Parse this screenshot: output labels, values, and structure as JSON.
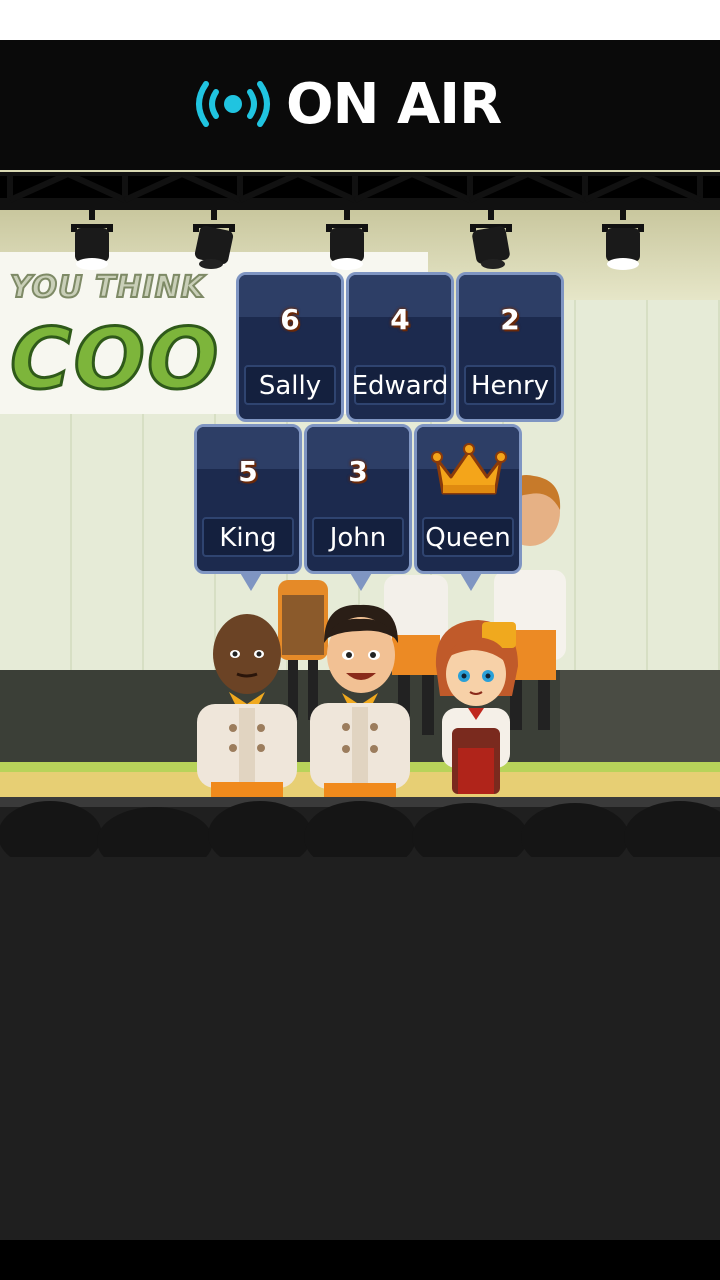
{
  "header": {
    "title": "ON AIR",
    "icon": "broadcast-icon"
  },
  "banner": {
    "line1": "YOU THINK",
    "line2": "COO"
  },
  "rankings": [
    {
      "rank": "6",
      "name": "Sally"
    },
    {
      "rank": "4",
      "name": "Edward"
    },
    {
      "rank": "2",
      "name": "Henry"
    },
    {
      "rank": "5",
      "name": "King"
    },
    {
      "rank": "3",
      "name": "John"
    },
    {
      "rank": "1",
      "name": "Queen",
      "icon": "crown-icon"
    }
  ],
  "colors": {
    "accent": "#20c4e0",
    "card": "#1c2a4e",
    "crown": "#f4a51a"
  }
}
